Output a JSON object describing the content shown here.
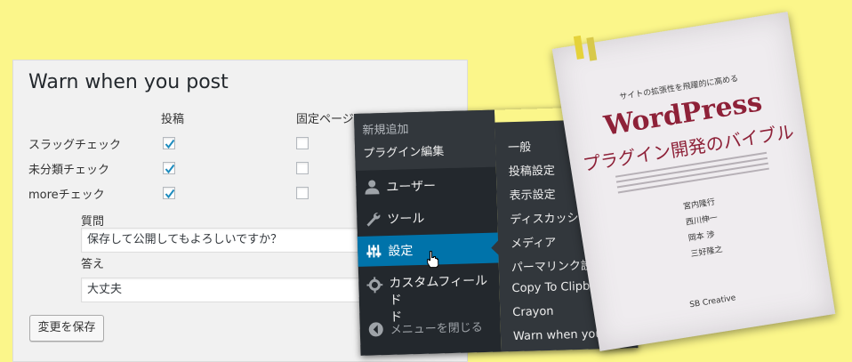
{
  "panel": {
    "title": "Warn when you post",
    "col_post": "投稿",
    "col_page": "固定ページ",
    "rows": [
      {
        "label": "スラッグチェック",
        "post": true,
        "page": false
      },
      {
        "label": "未分類チェック",
        "post": true,
        "page": false
      },
      {
        "label": "moreチェック",
        "post": true,
        "page": false
      }
    ],
    "question_label": "質問",
    "question_value": "保存して公開してもよろしいですか？",
    "answer_label": "答え",
    "answer_value": "大丈夫",
    "save_label": "変更を保存"
  },
  "menu": {
    "sub_top": [
      "新規追加",
      "プラグイン編集"
    ],
    "items": [
      {
        "label": "ユーザー",
        "icon": "user-icon"
      },
      {
        "label": "ツール",
        "icon": "wrench-icon"
      },
      {
        "label": "設定",
        "icon": "settings-sliders-icon"
      },
      {
        "label": "カスタムフィールド",
        "label2": "ド",
        "icon": "gear-icon"
      }
    ],
    "collapse_label": "メニューを閉じる",
    "submenu": [
      "一般",
      "投稿設定",
      "表示設定",
      "ディスカッション",
      "メディア",
      "パーマリンク設定",
      "Copy To Clipboard",
      "Crayon",
      "Warn when you post"
    ]
  },
  "book": {
    "subtitle_top": "サイトの拡張性を飛躍的に高める",
    "title": "WordPress",
    "subtitle": "プラグイン開発のバイブル",
    "authors": [
      "宮内隆行",
      "西川伸一",
      "岡本 渉",
      "三好隆之"
    ],
    "publisher": "SB Creative"
  },
  "colors": {
    "background": "#fbf68a",
    "admin_dark": "#23282d",
    "admin_sub": "#32373c",
    "accent": "#0073aa",
    "book_title": "#8e2138"
  }
}
